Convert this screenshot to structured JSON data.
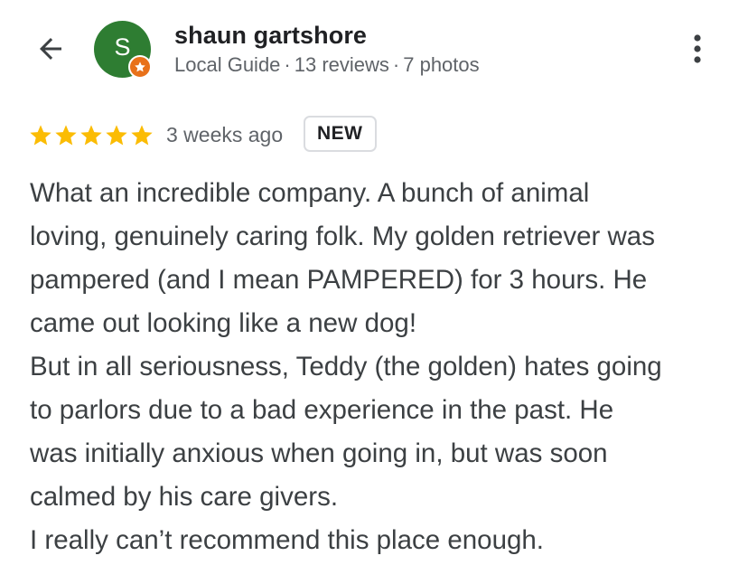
{
  "header": {
    "back_icon": "arrow-back-icon",
    "avatar_letter": "S",
    "avatar_color": "#2e7d32",
    "badge_icon": "local-guide-star-icon",
    "badge_color": "#e8711a",
    "reviewer_name": "shaun gartshore",
    "meta": {
      "guide_label": "Local Guide",
      "reviews": "13 reviews",
      "photos": "7 photos",
      "separator": "·"
    },
    "more_icon": "more-vert-icon"
  },
  "review": {
    "rating": 5,
    "rating_max": 5,
    "star_color": "#fbbc04",
    "time": "3 weeks ago",
    "badge": "NEW",
    "lines": [
      "What an incredible company. A bunch of animal",
      "loving, genuinely caring folk. My golden retriever was",
      "pampered (and I mean PAMPERED) for 3 hours. He",
      "came out looking like a new dog!",
      "But in all seriousness, Teddy (the golden) hates going",
      "to parlors due to a bad experience in the past. He",
      "was initially anxious when going in, but was soon",
      "calmed by his care givers.",
      "I really can’t recommend this place enough."
    ]
  }
}
